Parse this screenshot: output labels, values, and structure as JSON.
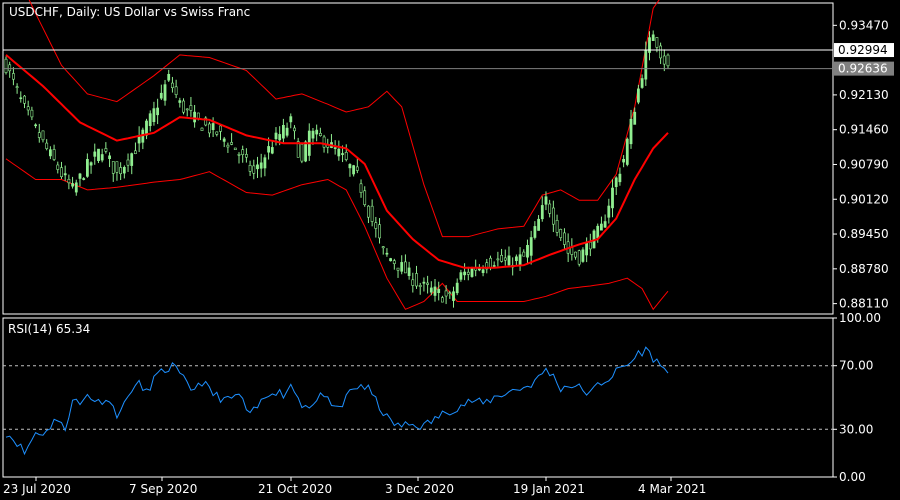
{
  "header": {
    "title": "USDCHF, Daily:  US Dollar vs Swiss Franc"
  },
  "rsi_panel": {
    "label": "RSI(14) 65.34"
  },
  "price_box": {
    "label": "0.92994"
  },
  "current_price_box": {
    "label": "0.92636"
  },
  "colors": {
    "background": "#000000",
    "frame": "#ffffff",
    "bull_candle": "#90ee90",
    "bear_candle": "#000000",
    "bands": "#ff0000",
    "ma": "#ff0000",
    "rsi": "#1e90ff",
    "level_line": "#ffffff",
    "current_line": "#808080"
  },
  "chart_data": [
    {
      "type": "candlestick",
      "title": "USDCHF, Daily:  US Dollar vs Swiss Franc",
      "x_ticks": [
        "23 Jul 2020",
        "7 Sep 2020",
        "21 Oct 2020",
        "3 Dec 2020",
        "19 Jan 2021",
        "4 Mar 2021"
      ],
      "y_ticks": [
        0.9347,
        0.9213,
        0.9146,
        0.9079,
        0.9012,
        0.8945,
        0.8878,
        0.8811
      ],
      "ylim": [
        0.8791,
        0.939
      ],
      "horizontal_line": 0.92994,
      "current_price": 0.92636,
      "close_anchors": [
        [
          0,
          0.927
        ],
        [
          5,
          0.9185
        ],
        [
          10,
          0.912
        ],
        [
          15,
          0.906
        ],
        [
          18,
          0.903
        ],
        [
          22,
          0.9075
        ],
        [
          26,
          0.911
        ],
        [
          30,
          0.906
        ],
        [
          35,
          0.911
        ],
        [
          40,
          0.918
        ],
        [
          44,
          0.9245
        ],
        [
          47,
          0.9195
        ],
        [
          52,
          0.916
        ],
        [
          57,
          0.914
        ],
        [
          62,
          0.911
        ],
        [
          67,
          0.906
        ],
        [
          72,
          0.912
        ],
        [
          77,
          0.916
        ],
        [
          80,
          0.908
        ],
        [
          82,
          0.914
        ],
        [
          86,
          0.9125
        ],
        [
          90,
          0.91
        ],
        [
          95,
          0.9055
        ],
        [
          98,
          0.899
        ],
        [
          102,
          0.891
        ],
        [
          107,
          0.888
        ],
        [
          112,
          0.8845
        ],
        [
          117,
          0.883
        ],
        [
          120,
          0.882
        ],
        [
          123,
          0.8865
        ],
        [
          127,
          0.888
        ],
        [
          132,
          0.8895
        ],
        [
          136,
          0.889
        ],
        [
          140,
          0.89
        ],
        [
          143,
          0.895
        ],
        [
          146,
          0.901
        ],
        [
          149,
          0.896
        ],
        [
          152,
          0.891
        ],
        [
          155,
          0.89
        ],
        [
          158,
          0.893
        ],
        [
          161,
          0.8955
        ],
        [
          164,
          0.903
        ],
        [
          167,
          0.909
        ],
        [
          170,
          0.919
        ],
        [
          173,
          0.929
        ],
        [
          175,
          0.9335
        ],
        [
          177,
          0.9295
        ],
        [
          179,
          0.9264
        ]
      ],
      "ma_anchors": [
        [
          0,
          0.929
        ],
        [
          10,
          0.923
        ],
        [
          20,
          0.916
        ],
        [
          30,
          0.9125
        ],
        [
          40,
          0.914
        ],
        [
          47,
          0.917
        ],
        [
          55,
          0.9165
        ],
        [
          65,
          0.9135
        ],
        [
          75,
          0.912
        ],
        [
          85,
          0.912
        ],
        [
          92,
          0.911
        ],
        [
          97,
          0.908
        ],
        [
          103,
          0.899
        ],
        [
          110,
          0.8935
        ],
        [
          117,
          0.8895
        ],
        [
          124,
          0.888
        ],
        [
          132,
          0.888
        ],
        [
          140,
          0.8885
        ],
        [
          147,
          0.8905
        ],
        [
          155,
          0.8925
        ],
        [
          160,
          0.8935
        ],
        [
          165,
          0.8975
        ],
        [
          170,
          0.905
        ],
        [
          175,
          0.911
        ],
        [
          179,
          0.914
        ]
      ],
      "upper_band_anchors": [
        [
          0,
          0.949
        ],
        [
          8,
          0.937
        ],
        [
          15,
          0.927
        ],
        [
          22,
          0.9215
        ],
        [
          30,
          0.92
        ],
        [
          40,
          0.925
        ],
        [
          47,
          0.929
        ],
        [
          55,
          0.9285
        ],
        [
          65,
          0.926
        ],
        [
          73,
          0.9205
        ],
        [
          80,
          0.9215
        ],
        [
          87,
          0.9195
        ],
        [
          92,
          0.918
        ],
        [
          98,
          0.919
        ],
        [
          103,
          0.922
        ],
        [
          107,
          0.919
        ],
        [
          113,
          0.904
        ],
        [
          118,
          0.894
        ],
        [
          125,
          0.894
        ],
        [
          133,
          0.8955
        ],
        [
          140,
          0.896
        ],
        [
          145,
          0.902
        ],
        [
          150,
          0.903
        ],
        [
          155,
          0.901
        ],
        [
          160,
          0.901
        ],
        [
          165,
          0.906
        ],
        [
          170,
          0.919
        ],
        [
          175,
          0.938
        ],
        [
          179,
          0.942
        ]
      ],
      "lower_band_anchors": [
        [
          0,
          0.909
        ],
        [
          8,
          0.905
        ],
        [
          15,
          0.905
        ],
        [
          22,
          0.903
        ],
        [
          30,
          0.9035
        ],
        [
          40,
          0.9045
        ],
        [
          47,
          0.905
        ],
        [
          55,
          0.9065
        ],
        [
          65,
          0.9025
        ],
        [
          72,
          0.902
        ],
        [
          80,
          0.904
        ],
        [
          87,
          0.905
        ],
        [
          92,
          0.903
        ],
        [
          97,
          0.896
        ],
        [
          103,
          0.886
        ],
        [
          108,
          0.88
        ],
        [
          113,
          0.8815
        ],
        [
          118,
          0.885
        ],
        [
          122,
          0.8815
        ],
        [
          130,
          0.8815
        ],
        [
          140,
          0.8815
        ],
        [
          146,
          0.8825
        ],
        [
          152,
          0.884
        ],
        [
          158,
          0.8845
        ],
        [
          163,
          0.885
        ],
        [
          168,
          0.886
        ],
        [
          172,
          0.884
        ],
        [
          175,
          0.88
        ],
        [
          179,
          0.8835
        ]
      ]
    },
    {
      "type": "line",
      "name": "RSI(14)",
      "value": 65.34,
      "ylim": [
        0,
        100
      ],
      "y_ticks": [
        100,
        70,
        30,
        0
      ],
      "levels": [
        70,
        30
      ],
      "anchors": [
        [
          0,
          28
        ],
        [
          3,
          22
        ],
        [
          5,
          15
        ],
        [
          8,
          28
        ],
        [
          11,
          28
        ],
        [
          13,
          37
        ],
        [
          16,
          30
        ],
        [
          18,
          50
        ],
        [
          20,
          45
        ],
        [
          22,
          52
        ],
        [
          25,
          47
        ],
        [
          27,
          50
        ],
        [
          30,
          40
        ],
        [
          32,
          45
        ],
        [
          34,
          56
        ],
        [
          36,
          58
        ],
        [
          38,
          53
        ],
        [
          40,
          62
        ],
        [
          43,
          67
        ],
        [
          45,
          70
        ],
        [
          47,
          64
        ],
        [
          50,
          55
        ],
        [
          53,
          60
        ],
        [
          56,
          52
        ],
        [
          60,
          48
        ],
        [
          63,
          52
        ],
        [
          66,
          38
        ],
        [
          69,
          47
        ],
        [
          72,
          55
        ],
        [
          75,
          52
        ],
        [
          77,
          58
        ],
        [
          80,
          46
        ],
        [
          83,
          45
        ],
        [
          86,
          53
        ],
        [
          88,
          42
        ],
        [
          91,
          45
        ],
        [
          93,
          54
        ],
        [
          96,
          58
        ],
        [
          98,
          55
        ],
        [
          100,
          48
        ],
        [
          103,
          37
        ],
        [
          106,
          32
        ],
        [
          110,
          33
        ],
        [
          113,
          32
        ],
        [
          117,
          38
        ],
        [
          120,
          42
        ],
        [
          123,
          45
        ],
        [
          126,
          48
        ],
        [
          129,
          46
        ],
        [
          132,
          50
        ],
        [
          135,
          53
        ],
        [
          138,
          55
        ],
        [
          141,
          57
        ],
        [
          144,
          62
        ],
        [
          146,
          68
        ],
        [
          148,
          63
        ],
        [
          150,
          56
        ],
        [
          153,
          58
        ],
        [
          156,
          55
        ],
        [
          158,
          52
        ],
        [
          160,
          58
        ],
        [
          163,
          62
        ],
        [
          166,
          68
        ],
        [
          169,
          72
        ],
        [
          171,
          78
        ],
        [
          173,
          80
        ],
        [
          175,
          75
        ],
        [
          177,
          70
        ],
        [
          179,
          65.34
        ]
      ]
    }
  ]
}
